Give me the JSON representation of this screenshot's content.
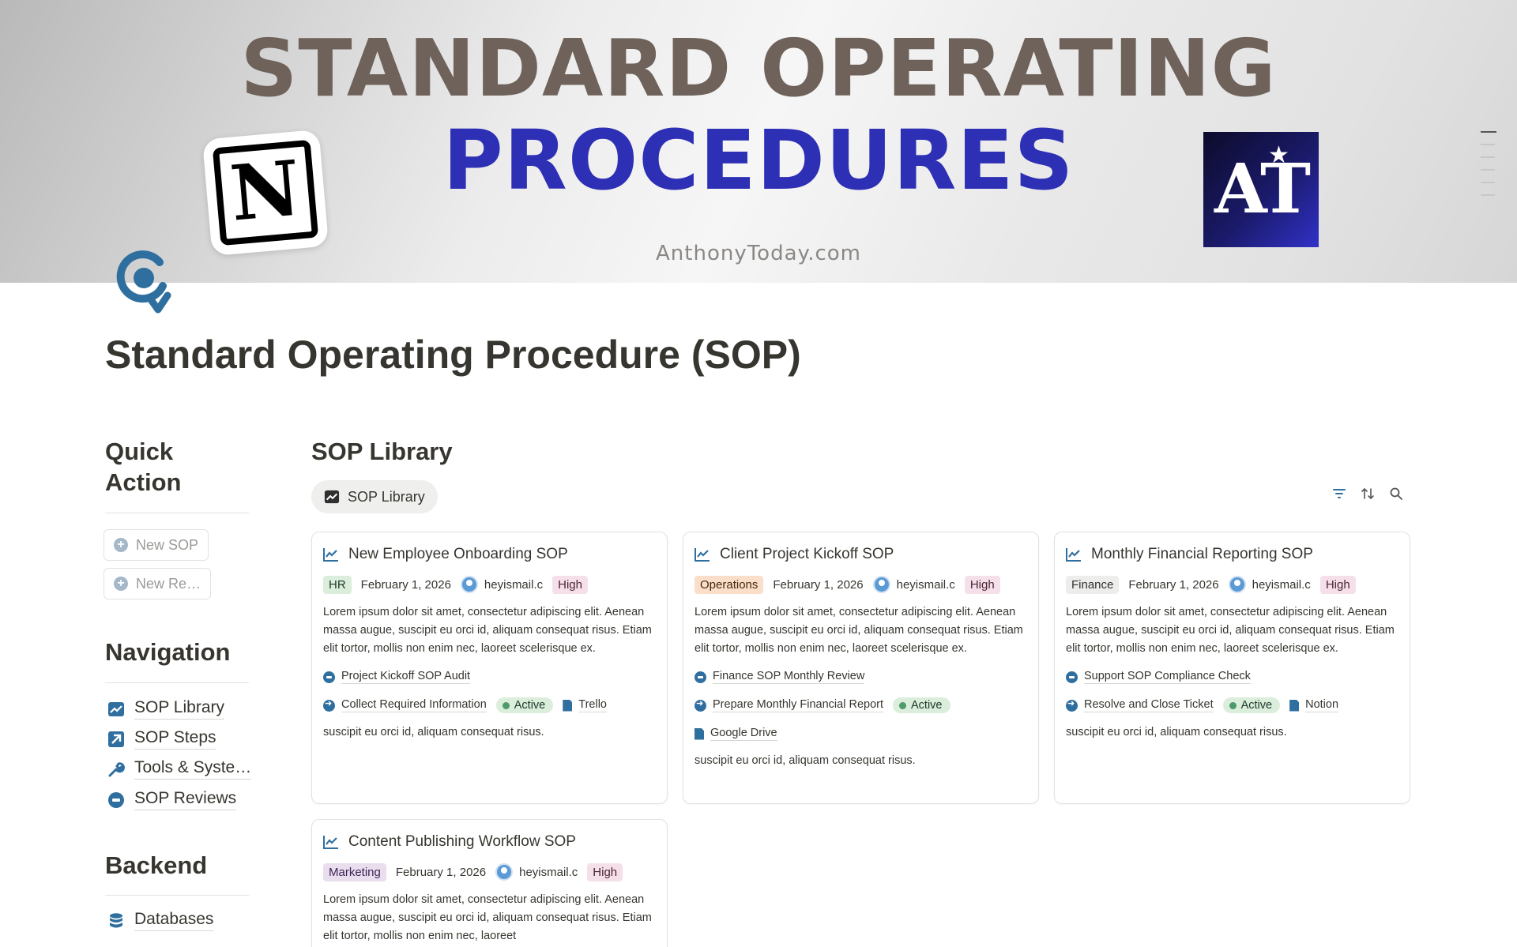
{
  "banner": {
    "line1": "STANDARD OPERATING",
    "line2": "PROCEDURES",
    "site": "AnthonyToday.com",
    "logo_left": "N",
    "logo_right": "AT"
  },
  "page": {
    "icon": "search-refresh-icon",
    "title": "Standard Operating Procedure (SOP)"
  },
  "sidebar": {
    "quick_action_heading": "Quick Action",
    "quick_actions": [
      {
        "label": "New SOP",
        "icon": "plus-circle-icon"
      },
      {
        "label": "New Re…",
        "icon": "plus-circle-icon"
      }
    ],
    "navigation_heading": "Navigation",
    "nav_items": [
      {
        "label": "SOP Library",
        "icon": "chart-line-icon"
      },
      {
        "label": "SOP Steps",
        "icon": "arrow-up-right-icon"
      },
      {
        "label": "Tools & Syste…",
        "icon": "wrench-icon"
      },
      {
        "label": "SOP Reviews",
        "icon": "minus-circle-icon"
      }
    ],
    "backend_heading": "Backend",
    "backend_items": [
      {
        "label": "Databases",
        "icon": "database-icon"
      }
    ]
  },
  "main": {
    "title": "SOP Library",
    "view_tab": "SOP Library",
    "tools": [
      "filter-icon",
      "sort-icon",
      "search-icon"
    ]
  },
  "cards": [
    {
      "title": "New Employee Onboarding SOP",
      "department": "HR",
      "date": "February 1, 2026",
      "owner": "heyismail.c",
      "priority": "High",
      "description": "Lorem ipsum dolor sit amet, consectetur adipiscing elit. Aenean massa augue, suscipit eu orci id, aliquam consequat risus. Etiam elit tortor, mollis non enim nec, laoreet scelerisque ex.",
      "review": "Project Kickoff SOP Audit",
      "step": "Collect Required Information",
      "status": "Active",
      "tool": "Trello",
      "tool2": "",
      "footer": "suscipit eu orci id, aliquam consequat risus."
    },
    {
      "title": "Client Project Kickoff SOP",
      "department": "Operations",
      "date": "February 1, 2026",
      "owner": "heyismail.c",
      "priority": "High",
      "description": "Lorem ipsum dolor sit amet, consectetur adipiscing elit. Aenean massa augue, suscipit eu orci id, aliquam consequat risus. Etiam elit tortor, mollis non enim nec, laoreet scelerisque ex.",
      "review": "Finance SOP Monthly Review",
      "step": "Prepare Monthly Financial Report",
      "status": "Active",
      "tool": "",
      "tool2": "Google Drive",
      "footer": "suscipit eu orci id, aliquam consequat risus."
    },
    {
      "title": "Monthly Financial Reporting SOP",
      "department": "Finance",
      "date": "February 1, 2026",
      "owner": "heyismail.c",
      "priority": "High",
      "description": "Lorem ipsum dolor sit amet, consectetur adipiscing elit. Aenean massa augue, suscipit eu orci id, aliquam consequat risus. Etiam elit tortor, mollis non enim nec, laoreet scelerisque ex.",
      "review": "Support SOP Compliance Check",
      "step": "Resolve and Close Ticket",
      "status": "Active",
      "tool": "Notion",
      "tool2": "",
      "footer": "suscipit eu orci id, aliquam consequat risus."
    },
    {
      "title": "Content Publishing Workflow SOP",
      "department": "Marketing",
      "date": "February 1, 2026",
      "owner": "heyismail.c",
      "priority": "High",
      "description": "Lorem ipsum dolor sit amet, consectetur adipiscing elit. Aenean massa augue, suscipit eu orci id, aliquam consequat risus. Etiam elit tortor, mollis non enim nec, laoreet",
      "review": "",
      "step": "",
      "status": "",
      "tool": "",
      "tool2": "",
      "footer": ""
    }
  ],
  "colors": {
    "tag_hr_bg": "#dbeddb",
    "tag_ops_bg": "#fadec9",
    "tag_finance_bg": "#ededec",
    "tag_marketing_bg": "#e8deee",
    "tag_high_bg": "#f5e0e9",
    "tag_high_text": "#4c2337",
    "icon_blue": "#2f6f9f"
  }
}
